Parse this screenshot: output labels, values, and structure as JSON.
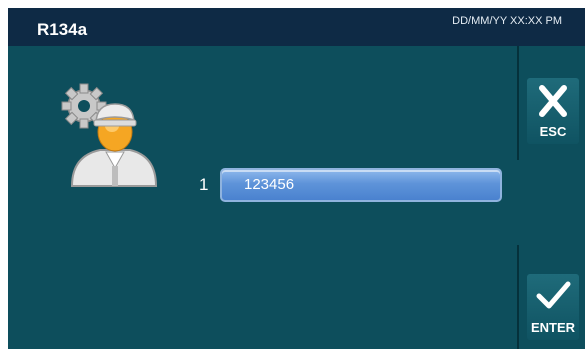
{
  "header": {
    "title": "R134a",
    "datetime": "DD/MM/YY XX:XX PM"
  },
  "main": {
    "icon": "technician-with-gear-icon",
    "entry_number": "1",
    "entry_value": "123456"
  },
  "buttons": {
    "esc_label": "ESC",
    "esc_icon": "close-x-icon",
    "enter_label": "ENTER",
    "enter_icon": "checkmark-icon"
  },
  "colors": {
    "titlebar": "#0e2a45",
    "panel": "#0d4e5c",
    "field": "#5e93d9"
  }
}
